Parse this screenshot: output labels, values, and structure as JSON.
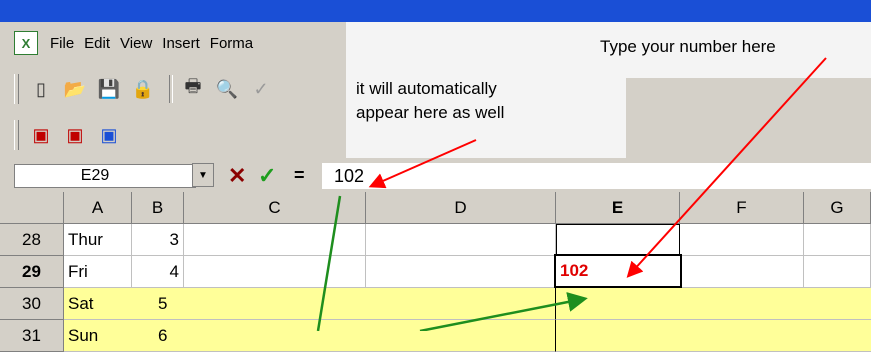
{
  "menu": {
    "items": [
      {
        "label": "File",
        "hotkey": "F"
      },
      {
        "label": "Edit",
        "hotkey": "E"
      },
      {
        "label": "View",
        "hotkey": "V"
      },
      {
        "label": "Insert",
        "hotkey": "I"
      },
      {
        "label": "Forma",
        "hotkey": "o"
      }
    ]
  },
  "callouts": {
    "type_here": "Type your number here",
    "appear_line1": "it will automatically",
    "appear_line2": "appear here as well"
  },
  "formula_bar": {
    "name_box": "E29",
    "cancel_symbol": "✕",
    "enter_symbol": "✓",
    "equals_symbol": "=",
    "value": "102"
  },
  "grid": {
    "columns": [
      "A",
      "B",
      "C",
      "D",
      "E",
      "F",
      "G"
    ],
    "rows": [
      {
        "num": "28",
        "a": "Thur",
        "b": "3"
      },
      {
        "num": "29",
        "a": "Fri",
        "b": "4"
      },
      {
        "num": "30",
        "a": "Sat",
        "b": "5"
      },
      {
        "num": "31",
        "a": "Sun",
        "b": "6"
      }
    ],
    "active_cell_value": "102"
  },
  "colors": {
    "highlight_rows": "#ffff99",
    "arrow_red": "#ff0000",
    "arrow_green": "#1e8e1e"
  }
}
